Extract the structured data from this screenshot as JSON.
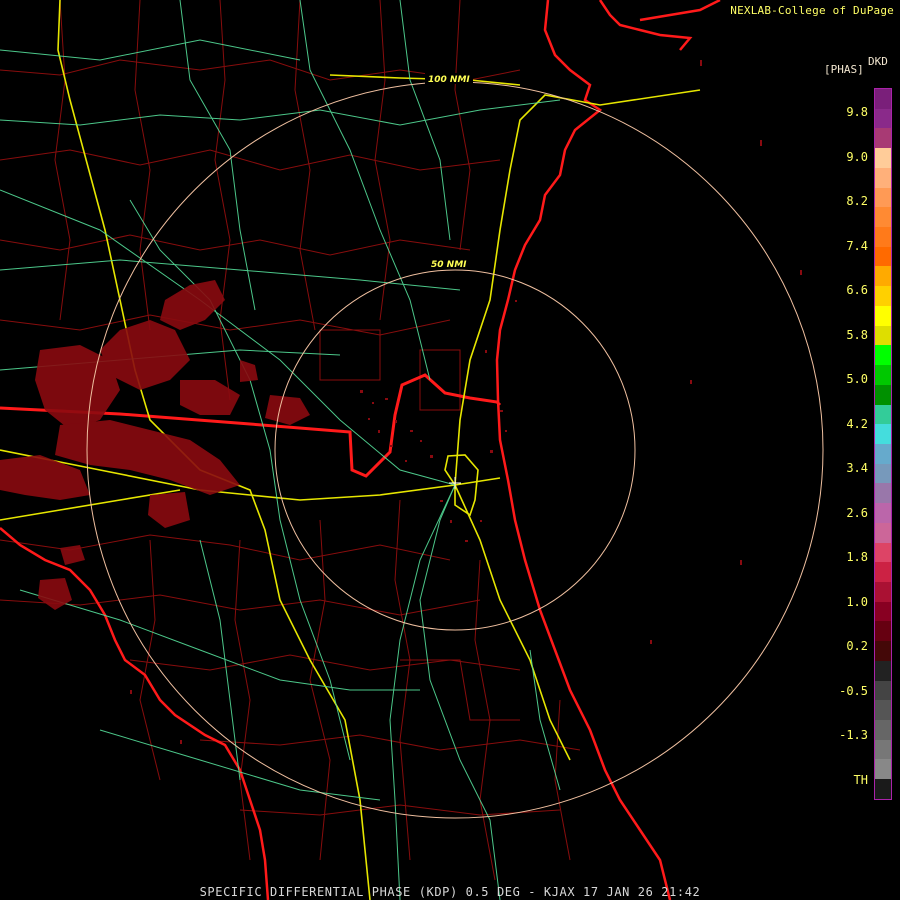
{
  "credit": "NEXLAB-College of DuPage",
  "legend": {
    "product": "DKD",
    "unit": "[PHAS]",
    "ticks": [
      "9.8",
      "9.0",
      "8.2",
      "7.4",
      "6.6",
      "5.8",
      "5.0",
      "4.2",
      "3.4",
      "2.6",
      "1.8",
      "1.0",
      "0.2",
      "-0.5",
      "-1.3",
      "TH"
    ],
    "colors": [
      "#7a1f7a",
      "#8a2a8a",
      "#a83a74",
      "#ffcc99",
      "#ffb07a",
      "#ff9a55",
      "#ff8a33",
      "#ff7a1a",
      "#ff6a00",
      "#ffaa00",
      "#ffd000",
      "#ffff00",
      "#dede00",
      "#00ff00",
      "#00c800",
      "#009000",
      "#33cc99",
      "#44dddd",
      "#66aacc",
      "#7799bb",
      "#9977aa",
      "#bb66aa",
      "#cc6699",
      "#dd4466",
      "#cc2244",
      "#aa1133",
      "#880022",
      "#660011",
      "#440808",
      "#222222",
      "#444444",
      "#555555",
      "#666666",
      "#777777",
      "#888888",
      "#1a1a1a"
    ]
  },
  "rings": {
    "inner_label": "50 NMI",
    "outer_label": "100 NMI"
  },
  "footer": "SPECIFIC DIFFERENTIAL PHASE (KDP) 0.5 DEG - KJAX 17 JAN 26 21:42"
}
